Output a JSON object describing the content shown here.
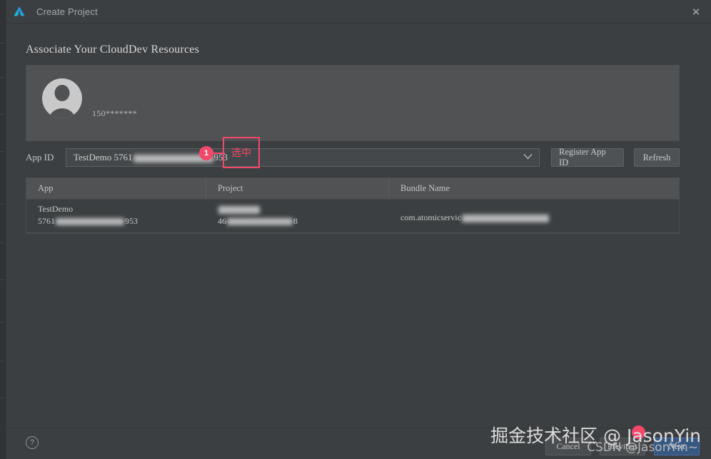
{
  "window": {
    "title": "Create Project",
    "logo_icon": "deveco-logo-icon",
    "close_icon": "close-icon"
  },
  "page": {
    "section_title": "Associate Your CloudDev Resources"
  },
  "profile": {
    "avatar_icon": "user-avatar-icon",
    "account_name": "150*******"
  },
  "appid": {
    "label": "App ID",
    "selected_value_prefix": "TestDemo 5761",
    "selected_value_suffix": "953",
    "dropdown_icon": "chevron-down-icon",
    "register_button": "Register App ID",
    "refresh_button": "Refresh"
  },
  "table": {
    "columns": [
      "App",
      "Project",
      "Bundle Name"
    ],
    "rows": [
      {
        "app_line1": "TestDemo",
        "app_line2_prefix": "5761",
        "app_line2_suffix": "953",
        "project_line1": "",
        "project_line2_prefix": "46",
        "project_line2_suffix": "8",
        "bundle_prefix": "com.atomicservic",
        "bundle_suffix": ""
      }
    ]
  },
  "annotation": {
    "badge_number": "1",
    "box_label": "选中",
    "accent_color": "#f2496b"
  },
  "footer": {
    "help_icon": "help-icon",
    "help_glyph": "?",
    "cancel_button": "Cancel",
    "previous_button": "Previous",
    "next_button": "Next"
  },
  "watermark": {
    "main": "掘金技术社区 @ JasonYin",
    "sub": "CSDN @JasonYin~"
  }
}
